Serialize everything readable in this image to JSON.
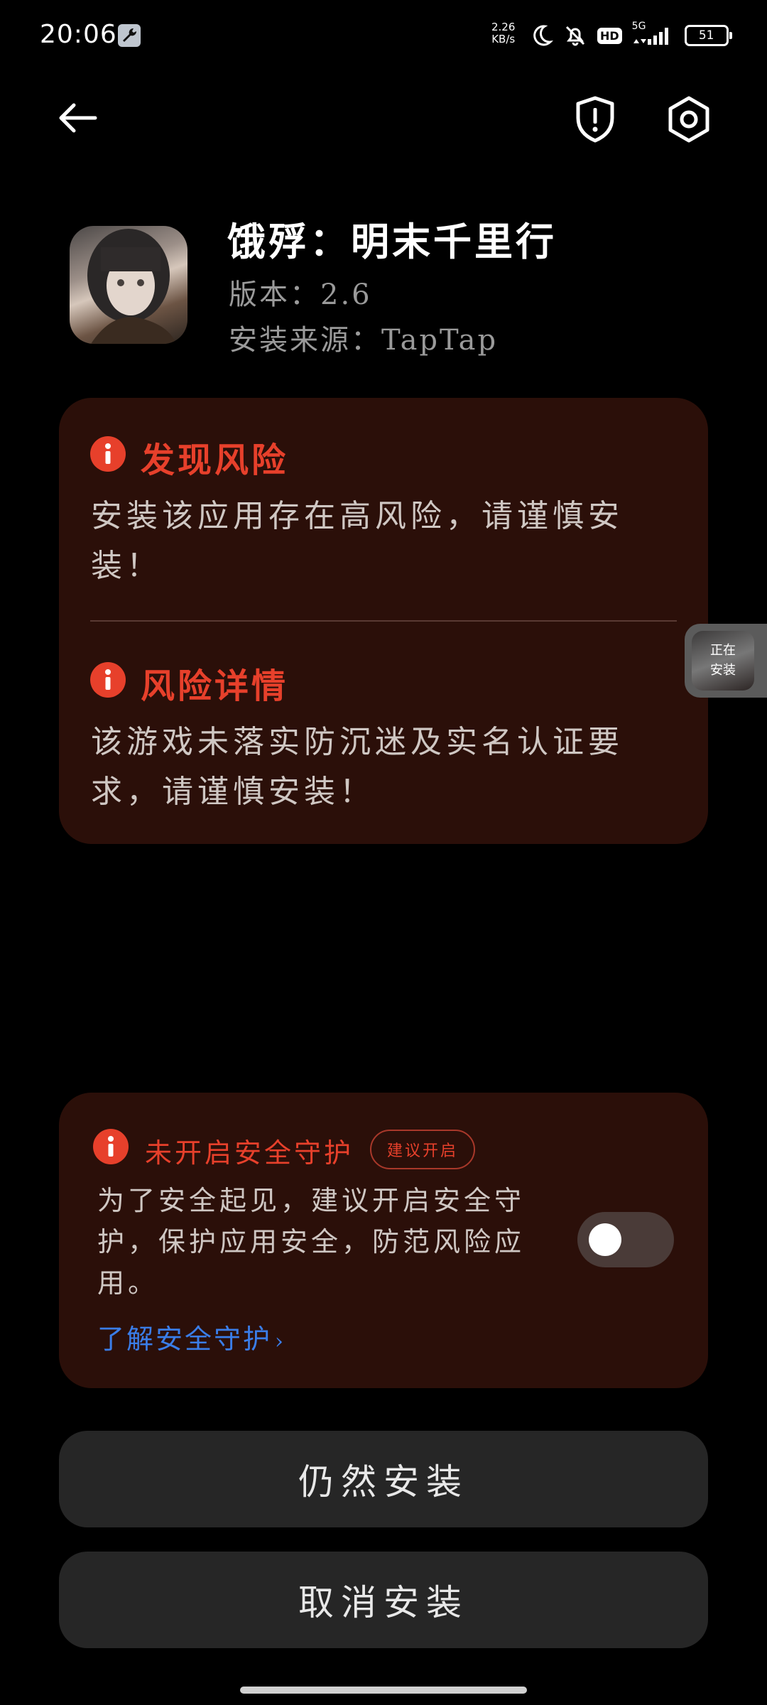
{
  "status_bar": {
    "time": "20:06",
    "net_speed_value": "2.26",
    "net_speed_unit": "KB/s",
    "network_type": "5G",
    "hd_label": "HD",
    "battery": "51"
  },
  "toolbar": {
    "back_icon": "arrow-left-icon",
    "shield_icon": "shield-alert-icon",
    "settings_icon": "settings-icon"
  },
  "app": {
    "name": "饿殍：明末千里行",
    "version": "版本：2.6",
    "source": "安装来源：TapTap"
  },
  "risk_card": {
    "found_heading": "发现风险",
    "found_text": "安装该应用存在高风险，请谨慎安装！",
    "details_heading": "风险详情",
    "details_text": "该游戏未落实防沉迷及实名认证要求，请谨慎安装！"
  },
  "floating_bubble": {
    "line1": "正在",
    "line2": "安装"
  },
  "protection": {
    "title": "未开启安全守护",
    "badge": "建议开启",
    "text": "为了安全起见，建议开启安全守护，保护应用安全，防范风险应用。",
    "link": "了解安全守护",
    "toggle_on": false
  },
  "buttons": {
    "install": "仍然安装",
    "cancel": "取消安装"
  },
  "colors": {
    "accent_red": "#e7402b",
    "card_bg": "#2b0f09",
    "link_blue": "#3a7de8"
  }
}
